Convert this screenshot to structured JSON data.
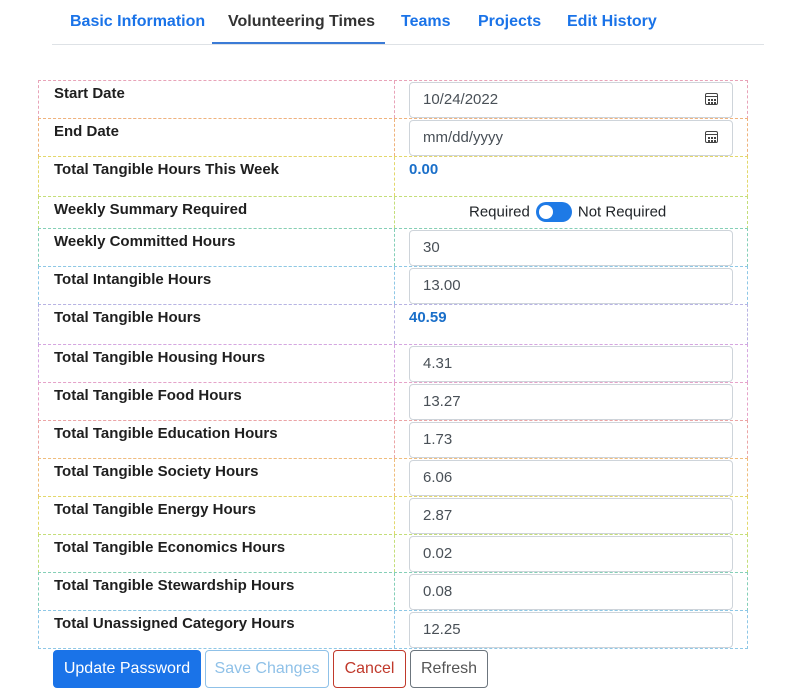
{
  "tabs": [
    {
      "label": "Basic Information"
    },
    {
      "label": "Volunteering Times"
    },
    {
      "label": "Teams"
    },
    {
      "label": "Projects"
    },
    {
      "label": "Edit History"
    }
  ],
  "active_tab": "Volunteering Times",
  "form": {
    "start_date": {
      "label": "Start Date",
      "value": "10/24/2022"
    },
    "end_date": {
      "label": "End Date",
      "placeholder": "mm/dd/yyyy"
    },
    "tangible_week": {
      "label": "Total Tangible Hours This Week",
      "value": "0.00"
    },
    "weekly_summary": {
      "label": "Weekly Summary Required",
      "left_label": "Required",
      "right_label": "Not Required",
      "state": "Not Required"
    },
    "weekly_committed": {
      "label": "Weekly Committed Hours",
      "value": "30"
    },
    "intangible": {
      "label": "Total Intangible Hours",
      "value": "13.00"
    },
    "tangible_total": {
      "label": "Total Tangible Hours",
      "value": "40.59"
    },
    "housing": {
      "label": "Total Tangible Housing Hours",
      "value": "4.31"
    },
    "food": {
      "label": "Total Tangible Food Hours",
      "value": "13.27"
    },
    "education": {
      "label": "Total Tangible Education Hours",
      "value": "1.73"
    },
    "society": {
      "label": "Total Tangible Society Hours",
      "value": "6.06"
    },
    "energy": {
      "label": "Total Tangible Energy Hours",
      "value": "2.87"
    },
    "economics": {
      "label": "Total Tangible Economics Hours",
      "value": "0.02"
    },
    "stewardship": {
      "label": "Total Tangible Stewardship Hours",
      "value": "0.08"
    },
    "unassigned": {
      "label": "Total Unassigned Category Hours",
      "value": "12.25"
    }
  },
  "buttons": {
    "update_password": "Update Password",
    "save_changes": "Save Changes",
    "cancel": "Cancel",
    "refresh": "Refresh"
  },
  "colors": {
    "primary": "#1a73e8",
    "value_blue": "#1a6fc9",
    "toggle": "#1e7ae6",
    "cancel_red": "#c0392b"
  }
}
